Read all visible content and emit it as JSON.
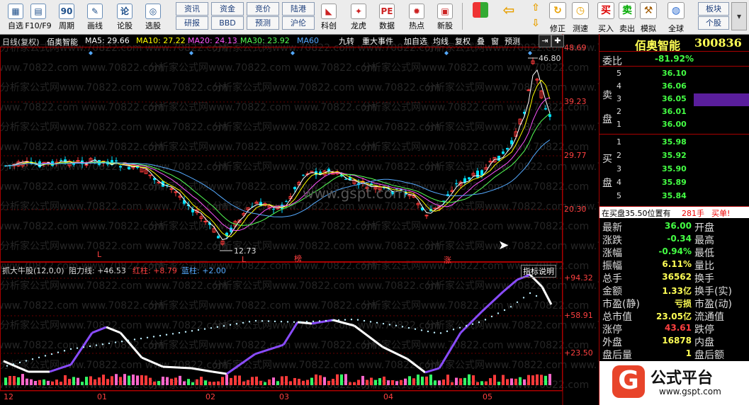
{
  "toolbar": {
    "left_buttons": [
      {
        "label": "自选",
        "icon": "self-select-icon",
        "glyph": "▦"
      },
      {
        "label": "F10/F9",
        "icon": "f10-icon",
        "glyph": "▤"
      },
      {
        "label": "周期",
        "icon": "period-icon",
        "glyph": "90"
      },
      {
        "label": "画线",
        "icon": "draw-line-icon",
        "glyph": "✎"
      },
      {
        "label": "论股",
        "icon": "discuss-icon",
        "glyph": "论"
      },
      {
        "label": "选股",
        "icon": "stock-select-icon",
        "glyph": "◎"
      }
    ],
    "grid_buttons": [
      "资讯",
      "资金",
      "竞价",
      "陆港",
      "研报",
      "BBD",
      "预测",
      "沪伦"
    ],
    "mid_buttons": [
      {
        "label": "科创",
        "icon": "kechuang-icon",
        "glyph": "◣"
      },
      {
        "label": "龙虎",
        "icon": "dragon-tiger-icon",
        "glyph": "✦"
      },
      {
        "label": "数据",
        "icon": "data-icon",
        "glyph": "PE"
      },
      {
        "label": "热点",
        "icon": "hotspot-icon",
        "glyph": "✹"
      },
      {
        "label": "新股",
        "icon": "new-stock-icon",
        "glyph": "▣"
      }
    ],
    "right_buttons": [
      {
        "label": "修正",
        "icon": "fix-icon",
        "glyph": "↻"
      },
      {
        "label": "测速",
        "icon": "speed-test-icon",
        "glyph": "◷"
      },
      {
        "label": "买入",
        "icon": "buy-icon",
        "glyph": "买"
      },
      {
        "label": "卖出",
        "icon": "sell-icon",
        "glyph": "卖"
      },
      {
        "label": "模拟",
        "icon": "simulate-icon",
        "glyph": "⚒"
      },
      {
        "label": "全球",
        "icon": "globe-icon",
        "glyph": "◍"
      }
    ],
    "far_right": [
      "板块",
      "个股"
    ]
  },
  "main_chart": {
    "period_label": "日线(复权)",
    "stock_name": "佰奥智能",
    "ma": [
      {
        "label": "MA5: 29.66",
        "color": "#ffffff"
      },
      {
        "label": "MA10: 27.22",
        "color": "#ffff00"
      },
      {
        "label": "MA20: 24.13",
        "color": "#ff55ff"
      },
      {
        "label": "MA30: 23.92",
        "color": "#55ff55"
      },
      {
        "label": "MA60",
        "color": "#55aaff"
      }
    ],
    "tabs": [
      "九转",
      "重大事件",
      "加自选",
      "均线",
      "复权",
      "叠",
      "窗",
      "预测"
    ],
    "price_axis": [
      "48.69",
      "39.23",
      "29.77",
      "20.30"
    ],
    "high_label": "46.80",
    "low_label": "12.73",
    "markers": [
      "L",
      "L",
      "榜",
      "涨"
    ],
    "watermark": "www.gspt.com"
  },
  "indicator": {
    "name": "抓大牛股(12,0,0)",
    "resistance": "阻力线: +46.53",
    "red": "红柱: +8.79",
    "blue": "蓝柱: +2.00",
    "button": "指标说明",
    "axis": [
      "+94.32",
      "+58.91",
      "+23.50"
    ]
  },
  "time_axis": [
    "12",
    "01",
    "02",
    "03",
    "04",
    "05"
  ],
  "sidebar": {
    "title": "佰奥智能",
    "code": "300836",
    "ratio_label": "委比",
    "ratio_value": "-81.92%",
    "sell_label": "卖盘",
    "buy_label": "买盘",
    "asks": [
      {
        "n": "5",
        "p": "36.10"
      },
      {
        "n": "4",
        "p": "36.06"
      },
      {
        "n": "3",
        "p": "36.05"
      },
      {
        "n": "2",
        "p": "36.01"
      },
      {
        "n": "1",
        "p": "36.00"
      }
    ],
    "bids": [
      {
        "n": "1",
        "p": "35.98"
      },
      {
        "n": "2",
        "p": "35.92"
      },
      {
        "n": "3",
        "p": "35.90"
      },
      {
        "n": "4",
        "p": "35.89"
      },
      {
        "n": "5",
        "p": "35.84"
      }
    ],
    "notice_text": "在买盘35.50位置有",
    "notice_qty": "281手",
    "notice_action": "买单!",
    "stats": [
      {
        "l": "最新",
        "v": "36.00",
        "r": "开盘"
      },
      {
        "l": "涨跌",
        "v": "-0.34",
        "r": "最高"
      },
      {
        "l": "涨幅",
        "v": "-0.94%",
        "r": "最低"
      },
      {
        "l": "振幅",
        "v": "6.11%",
        "r": "量比"
      },
      {
        "l": "总手",
        "v": "36562",
        "r": "换手"
      },
      {
        "l": "金额",
        "v": "1.33亿",
        "r": "换手(实)"
      },
      {
        "l": "市盈(静)",
        "v": "亏损",
        "r": "市盈(动)"
      },
      {
        "l": "总市值",
        "v": "23.05亿",
        "r": "流通值"
      },
      {
        "l": "涨停",
        "v": "43.61",
        "r": "跌停"
      },
      {
        "l": "外盘",
        "v": "16878",
        "r": "内盘"
      },
      {
        "l": "盘后量",
        "v": "1",
        "r": "盘后额"
      }
    ],
    "logo_text": "公式平台",
    "logo_url": "www.gspt.com"
  },
  "chart_watermark": "分析家公式网www.70822.com"
}
